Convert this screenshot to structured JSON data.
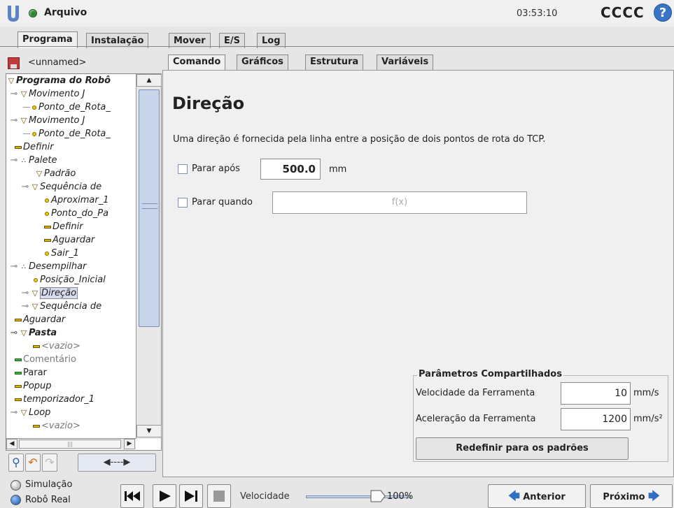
{
  "app": {
    "file_title": "Arquivo",
    "clock": "03:53:10",
    "robot_name": "CCCC",
    "help_symbol": "?"
  },
  "main_tabs": [
    "Programa",
    "Instalação",
    "Mover",
    "E/S",
    "Log"
  ],
  "program": {
    "name": "<unnamed>"
  },
  "sub_tabs": [
    "Comando",
    "Gráficos",
    "Estrutura",
    "Variáveis"
  ],
  "tree": [
    {
      "label": "Programa do Robô",
      "icon": "triangle-icon"
    },
    {
      "label": "Movimento J",
      "icon": "triangle-icon"
    },
    {
      "label": "Ponto_de_Rota_",
      "icon": "waypoint-icon"
    },
    {
      "label": "Movimento J",
      "icon": "triangle-icon"
    },
    {
      "label": "Ponto_de_Rota_",
      "icon": "waypoint-icon"
    },
    {
      "label": "Definir",
      "icon": "dash-icon"
    },
    {
      "label": "Palete",
      "icon": "pallet-icon"
    },
    {
      "label": "Padrão",
      "icon": "triangle-icon"
    },
    {
      "label": "Sequência de",
      "icon": "triangle-icon"
    },
    {
      "label": "Aproximar_1",
      "icon": "waypoint-icon"
    },
    {
      "label": "Ponto_do_Pa",
      "icon": "waypoint-icon"
    },
    {
      "label": "Definir",
      "icon": "dash-icon"
    },
    {
      "label": "Aguardar",
      "icon": "dash-icon"
    },
    {
      "label": "Sair_1",
      "icon": "waypoint-icon"
    },
    {
      "label": "Desempilhar",
      "icon": "pallet-icon"
    },
    {
      "label": "Posição_Inicial",
      "icon": "waypoint-icon"
    },
    {
      "label": "Direção",
      "icon": "triangle-icon"
    },
    {
      "label": "Sequência de",
      "icon": "triangle-icon"
    },
    {
      "label": "Aguardar",
      "icon": "dash-icon"
    },
    {
      "label": "Pasta",
      "icon": "triangle-icon"
    },
    {
      "label": "<vazio>",
      "icon": "dash-icon"
    },
    {
      "label": "Comentário",
      "icon": "dash-icon"
    },
    {
      "label": "Parar",
      "icon": "dash-icon"
    },
    {
      "label": "Popup",
      "icon": "dash-icon"
    },
    {
      "label": "temporizador_1",
      "icon": "dash-icon"
    },
    {
      "label": "Loop",
      "icon": "triangle-icon"
    },
    {
      "label": "<vazio>",
      "icon": "dash-icon"
    }
  ],
  "tree_tools": {
    "move_label": "◀----▶"
  },
  "command": {
    "heading": "Direção",
    "description": "Uma direção é fornecida pela linha entre a posição de dois pontos de rota do TCP.",
    "stop_after_label": "Parar após",
    "stop_after_value": "500.0",
    "stop_after_unit": "mm",
    "stop_when_label": "Parar quando",
    "stop_when_placeholder": "f(x)"
  },
  "shared": {
    "title": "Parâmetros Compartilhados",
    "tool_speed_label": "Velocidade da Ferramenta",
    "tool_speed_value": "10",
    "tool_speed_unit": "mm/s",
    "tool_accel_label": "Aceleração da Ferramenta",
    "tool_accel_value": "1200",
    "tool_accel_unit": "mm/s²",
    "reset_label": "Redefinir para os padrões"
  },
  "footer": {
    "simulation_label": "Simulação",
    "real_robot_label": "Robô Real",
    "speed_label": "Velocidade",
    "speed_value": "100%",
    "speed_fraction": 1.0,
    "prev_label": "Anterior",
    "next_label": "Próximo"
  }
}
